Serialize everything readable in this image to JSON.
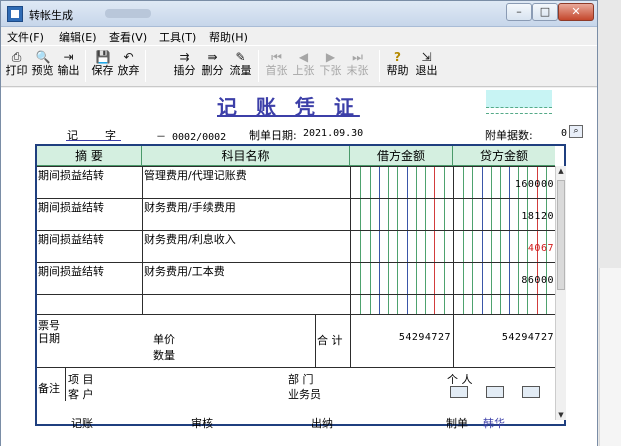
{
  "window": {
    "title": "转帐生成",
    "minimize": "–",
    "maximize": "□",
    "close": "✕"
  },
  "menu": [
    "文件(F)",
    "编辑(E)",
    "查看(V)",
    "工具(T)",
    "帮助(H)"
  ],
  "toolbar": [
    {
      "label": "打印",
      "icon": "printer-icon",
      "glyph": "⎙",
      "enabled": true
    },
    {
      "label": "预览",
      "icon": "preview-icon",
      "glyph": "🔍",
      "enabled": true
    },
    {
      "label": "输出",
      "icon": "export-icon",
      "glyph": "⇥",
      "enabled": true
    },
    {
      "label": "保存",
      "icon": "save-icon",
      "glyph": "💾",
      "enabled": true
    },
    {
      "label": "放弃",
      "icon": "undo-icon",
      "glyph": "↶",
      "enabled": true
    },
    {
      "label": "插分",
      "icon": "insert-row-icon",
      "glyph": "⇉",
      "enabled": true
    },
    {
      "label": "删分",
      "icon": "delete-row-icon",
      "glyph": "⇛",
      "enabled": true
    },
    {
      "label": "流量",
      "icon": "cashflow-icon",
      "glyph": "✎",
      "enabled": true
    },
    {
      "label": "首张",
      "icon": "first-icon",
      "glyph": "⏮",
      "enabled": false
    },
    {
      "label": "上张",
      "icon": "prev-icon",
      "glyph": "◀",
      "enabled": false
    },
    {
      "label": "下张",
      "icon": "next-icon",
      "glyph": "▶",
      "enabled": false
    },
    {
      "label": "末张",
      "icon": "last-icon",
      "glyph": "⏭",
      "enabled": false
    },
    {
      "label": "帮助",
      "icon": "help-icon",
      "glyph": "?",
      "enabled": true
    },
    {
      "label": "退出",
      "icon": "exit-icon",
      "glyph": "⇲",
      "enabled": true
    }
  ],
  "voucher": {
    "title": "记 账 凭 证",
    "type_label": "记",
    "type_suffix": "字",
    "number": "－ 0002/0002",
    "date_label": "制单日期:",
    "date_value": "2021.09.30",
    "attach_label": "附单据数:",
    "attach_value": "0",
    "headers": {
      "summary": "摘 要",
      "account": "科目名称",
      "debit": "借方金额",
      "credit": "贷方金额"
    },
    "rows": [
      {
        "summary": "期间损益结转",
        "account": "管理费用/代理记账费",
        "credit": "160000",
        "credit_color": "#000000"
      },
      {
        "summary": "期间损益结转",
        "account": "财务费用/手续费用",
        "credit": "18120",
        "credit_color": "#000000"
      },
      {
        "summary": "期间损益结转",
        "account": "财务费用/利息收入",
        "credit": "4067",
        "credit_color": "#d01a1a"
      },
      {
        "summary": "期间损益结转",
        "account": "财务费用/工本费",
        "credit": "86000",
        "credit_color": "#000000"
      },
      {
        "summary": "",
        "account": "",
        "credit": "",
        "credit_color": "#000000"
      }
    ],
    "footer": {
      "ticket_no": "票号",
      "date": "日期",
      "unit_price": "单价",
      "quantity": "数量",
      "total_label": "合 计",
      "total_debit": "54294727",
      "total_credit": "54294727",
      "remark": "备注",
      "project": "项 目",
      "customer": "客 户",
      "department": "部 门",
      "staff": "业务员",
      "person": "个 人"
    },
    "signatures": {
      "bookkeeper": "记账",
      "auditor": "审核",
      "cashier": "出纳",
      "maker_label": "制单",
      "maker_name": "韩华",
      "maker_color": "#3c3fa8"
    }
  }
}
